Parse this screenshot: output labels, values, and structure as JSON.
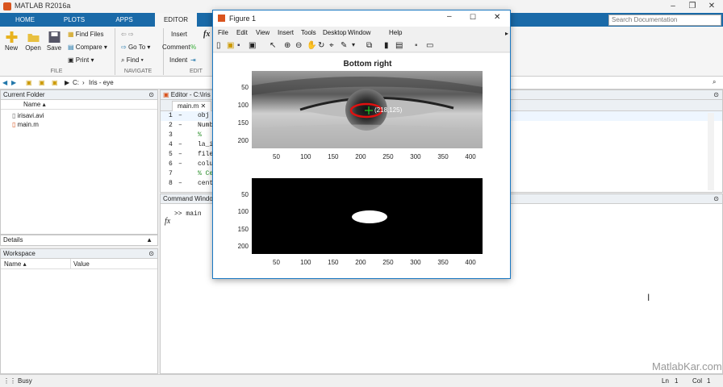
{
  "app": {
    "title": "MATLAB R2016a"
  },
  "tabs": [
    {
      "label": "HOME"
    },
    {
      "label": "PLOTS"
    },
    {
      "label": "APPS"
    },
    {
      "label": "EDITOR"
    }
  ],
  "search": {
    "placeholder": "Search Documentation"
  },
  "ribbon": {
    "new": "New",
    "open": "Open",
    "save": "Save",
    "find_files": "Find Files",
    "compare": "Compare",
    "print": "Print",
    "file_group": "FILE",
    "go_to": "Go To",
    "find": "Find",
    "navigate_group": "NAVIGATE",
    "insert": "Insert",
    "comment": "Comment",
    "indent": "Indent",
    "edit_group": "EDIT",
    "fx": "fx"
  },
  "address": {
    "drive": "C:",
    "sep": "›",
    "path1": "Iris - eye"
  },
  "current_folder": {
    "title": "Current Folder",
    "col_name": "Name",
    "files": [
      {
        "name": "irisavi.avi"
      },
      {
        "name": "main.m"
      }
    ]
  },
  "details": {
    "title": "Details"
  },
  "workspace": {
    "title": "Workspace",
    "col_name": "Name",
    "col_value": "Value"
  },
  "editor": {
    "title": "Editor - C:\\Iris",
    "tab": "main.m",
    "lines": [
      {
        "n": "1",
        "dash": "–",
        "text": "obj"
      },
      {
        "n": "2",
        "dash": "–",
        "text": "Numb"
      },
      {
        "n": "3",
        "dash": "",
        "text": "%"
      },
      {
        "n": "4",
        "dash": "–",
        "text": "la_i"
      },
      {
        "n": "5",
        "dash": "–",
        "text": "file"
      },
      {
        "n": "6",
        "dash": "–",
        "text": "colu"
      },
      {
        "n": "7",
        "dash": "",
        "text": "% Ce"
      },
      {
        "n": "8",
        "dash": "–",
        "text": "cent"
      }
    ]
  },
  "command_window": {
    "title": "Command Windo",
    "prompt": ">>",
    "command": "main",
    "fx": "fx"
  },
  "status": {
    "text": "Busy",
    "ln": "Ln",
    "ln_val": "1",
    "col": "Col",
    "col_val": "1"
  },
  "watermark": "MatlabKar.com",
  "figure": {
    "title": "Figure 1",
    "menu": [
      "File",
      "Edit",
      "View",
      "Insert",
      "Tools",
      "Desktop",
      "Window",
      "Help"
    ],
    "plot1": {
      "title": "Bottom right",
      "annotation": "(218,125)",
      "x_ticks": [
        "50",
        "100",
        "150",
        "200",
        "250",
        "300",
        "350",
        "400"
      ],
      "y_ticks": [
        "50",
        "100",
        "150",
        "200"
      ]
    },
    "plot2": {
      "x_ticks": [
        "50",
        "100",
        "150",
        "200",
        "250",
        "300",
        "350",
        "400"
      ],
      "y_ticks": [
        "50",
        "100",
        "150",
        "200"
      ]
    }
  },
  "colors": {
    "accent": "#1a6aa8",
    "ellipse": "#e01010",
    "marker": "#22cc22"
  }
}
